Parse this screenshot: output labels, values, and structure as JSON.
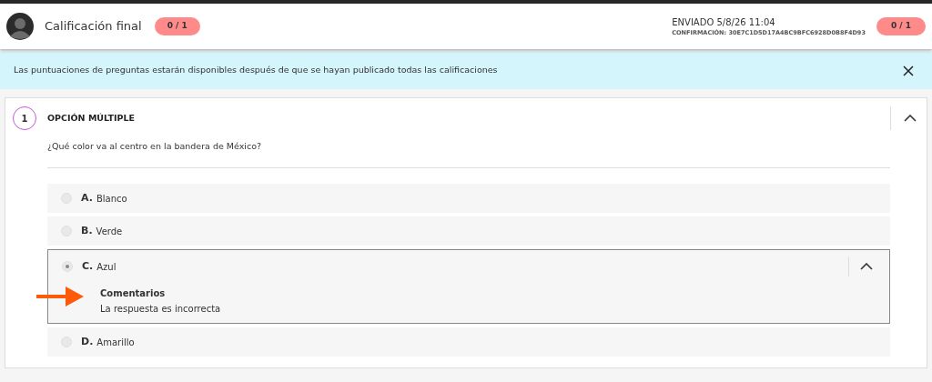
{
  "header": {
    "title": "Calificación final",
    "score": "0 / 1",
    "submitted": "ENVIADO 5/8/26 11:04",
    "confirmation": "CONFIRMACIÓN: 30E7C1D5D17A4BC9BFC6928D0B8F4D93",
    "final_score": "0 / 1"
  },
  "banner": {
    "text": "Las puntuaciones de preguntas estarán disponibles después de que se hayan publicado todas las calificaciones"
  },
  "question": {
    "number": "1",
    "type": "OPCIÓN MÚLTIPLE",
    "expanded": true,
    "text": "¿Qué color va al centro en la bandera de México?",
    "options": [
      {
        "letter": "A.",
        "text": "Blanco",
        "selected": false,
        "expanded": false
      },
      {
        "letter": "B.",
        "text": "Verde",
        "selected": false,
        "expanded": false
      },
      {
        "letter": "C.",
        "text": "Azul",
        "selected": true,
        "expanded": true,
        "feedback": {
          "title": "Comentarios",
          "text": "La respuesta es incorrecta"
        }
      },
      {
        "letter": "D.",
        "text": "Amarillo",
        "selected": false,
        "expanded": false
      }
    ]
  }
}
